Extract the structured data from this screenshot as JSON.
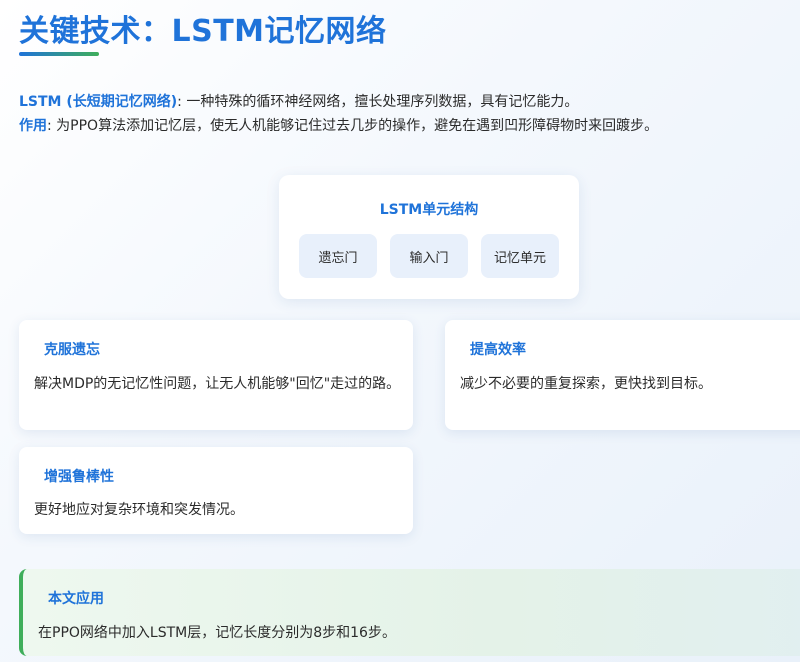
{
  "header": {
    "title": "关键技术：LSTM记忆网络"
  },
  "intro": {
    "line1_key": "LSTM (长短期记忆网络)",
    "line1_text": ": 一种特殊的循环神经网络，擅长处理序列数据，具有记忆能力。",
    "line2_key": "作用",
    "line2_text": ": 为PPO算法添加记忆层，使无人机能够记住过去几步的操作，避免在遇到凹形障碍物时来回踱步。"
  },
  "lstm_structure": {
    "title": "LSTM单元结构",
    "gates": [
      "遗忘门",
      "输入门",
      "记忆单元"
    ]
  },
  "cards": [
    {
      "title": "克服遗忘",
      "text": "解决MDP的无记忆性问题，让无人机能够\"回忆\"走过的路。"
    },
    {
      "title": "提高效率",
      "text": "减少不必要的重复探索，更快找到目标。"
    },
    {
      "title": "增强鲁棒性",
      "text": "更好地应对复杂环境和突发情况。"
    }
  ],
  "application": {
    "title": "本文应用",
    "text": "在PPO网络中加入LSTM层，记忆长度分别为8步和16步。"
  },
  "colors": {
    "accent_blue": "#1f73d9",
    "accent_green": "#3fae5a"
  }
}
